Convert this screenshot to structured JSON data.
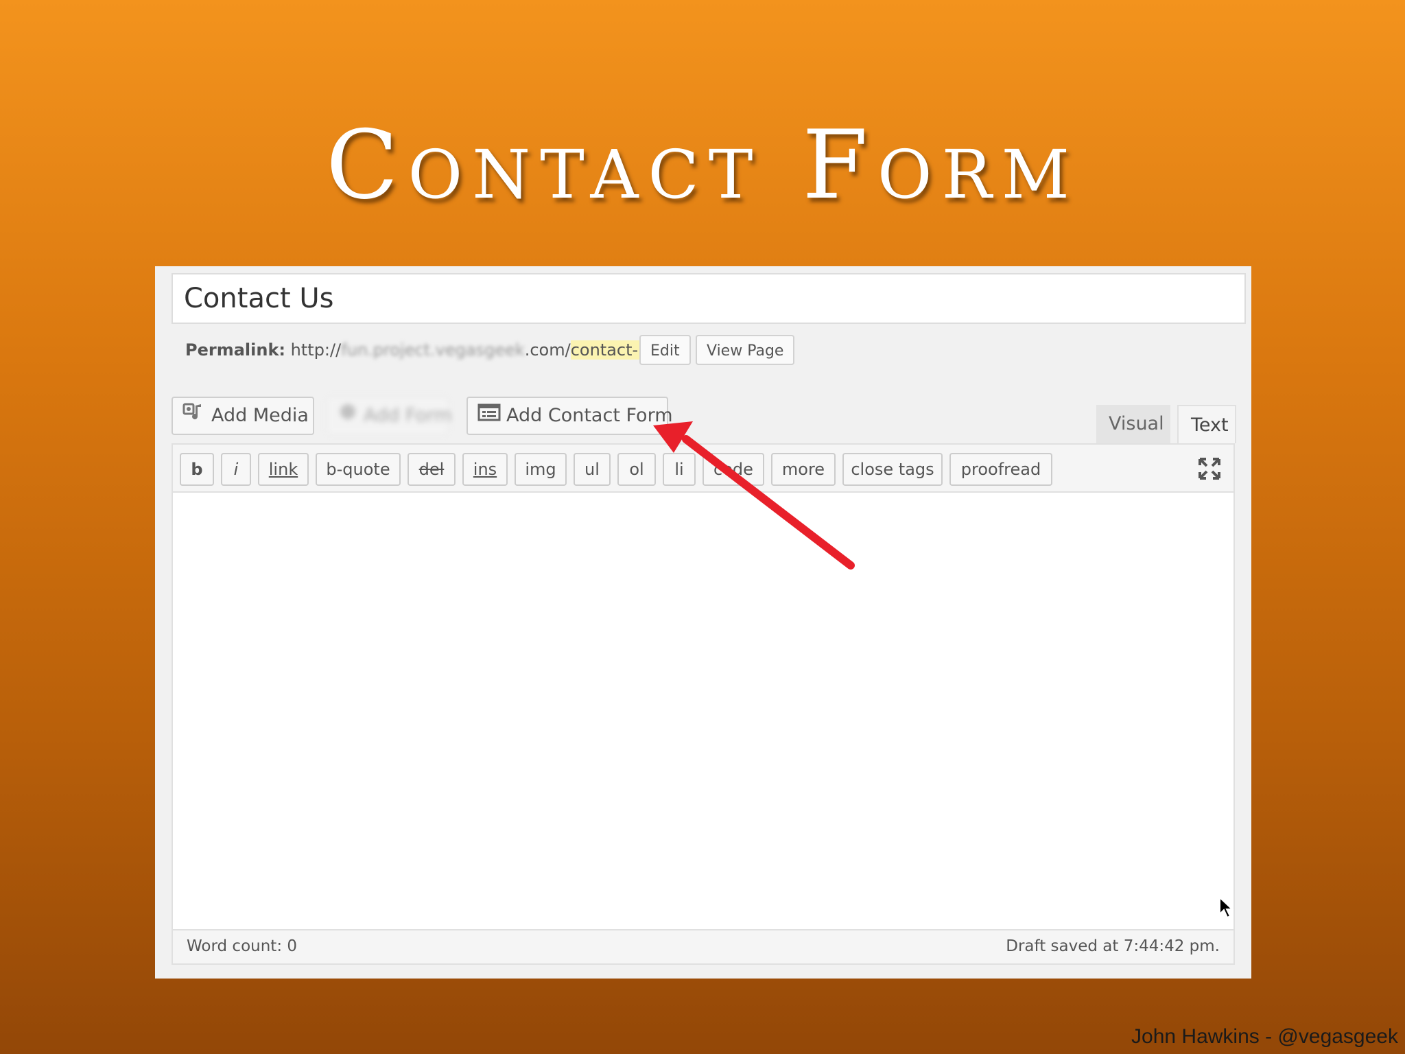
{
  "slide": {
    "title": "Contact Form",
    "credit": "John Hawkins - @vegasgeek"
  },
  "editor": {
    "post_title": "Contact Us",
    "permalink": {
      "label": "Permalink:",
      "prefix": "http://",
      "blurred_domain": "fun.project.vegasgeek",
      "domain_suffix": ".com/",
      "slug": "contact-us",
      "trailing": "/",
      "edit_label": "Edit",
      "view_label": "View Page"
    },
    "media_buttons": {
      "add_media": "Add Media",
      "blurred": "Add Form",
      "add_contact_form": "Add Contact Form"
    },
    "tabs": {
      "visual": "Visual",
      "text": "Text"
    },
    "quicktags": [
      "b",
      "i",
      "link",
      "b-quote",
      "del",
      "ins",
      "img",
      "ul",
      "ol",
      "li",
      "code",
      "more",
      "close tags",
      "proofread"
    ],
    "content": "",
    "status": {
      "word_count": "Word count: 0",
      "draft_saved": "Draft saved at 7:44:42 pm."
    },
    "accent_colors": {
      "arrow": "#e8202a",
      "slug_highlight": "#fbf3b1"
    }
  }
}
